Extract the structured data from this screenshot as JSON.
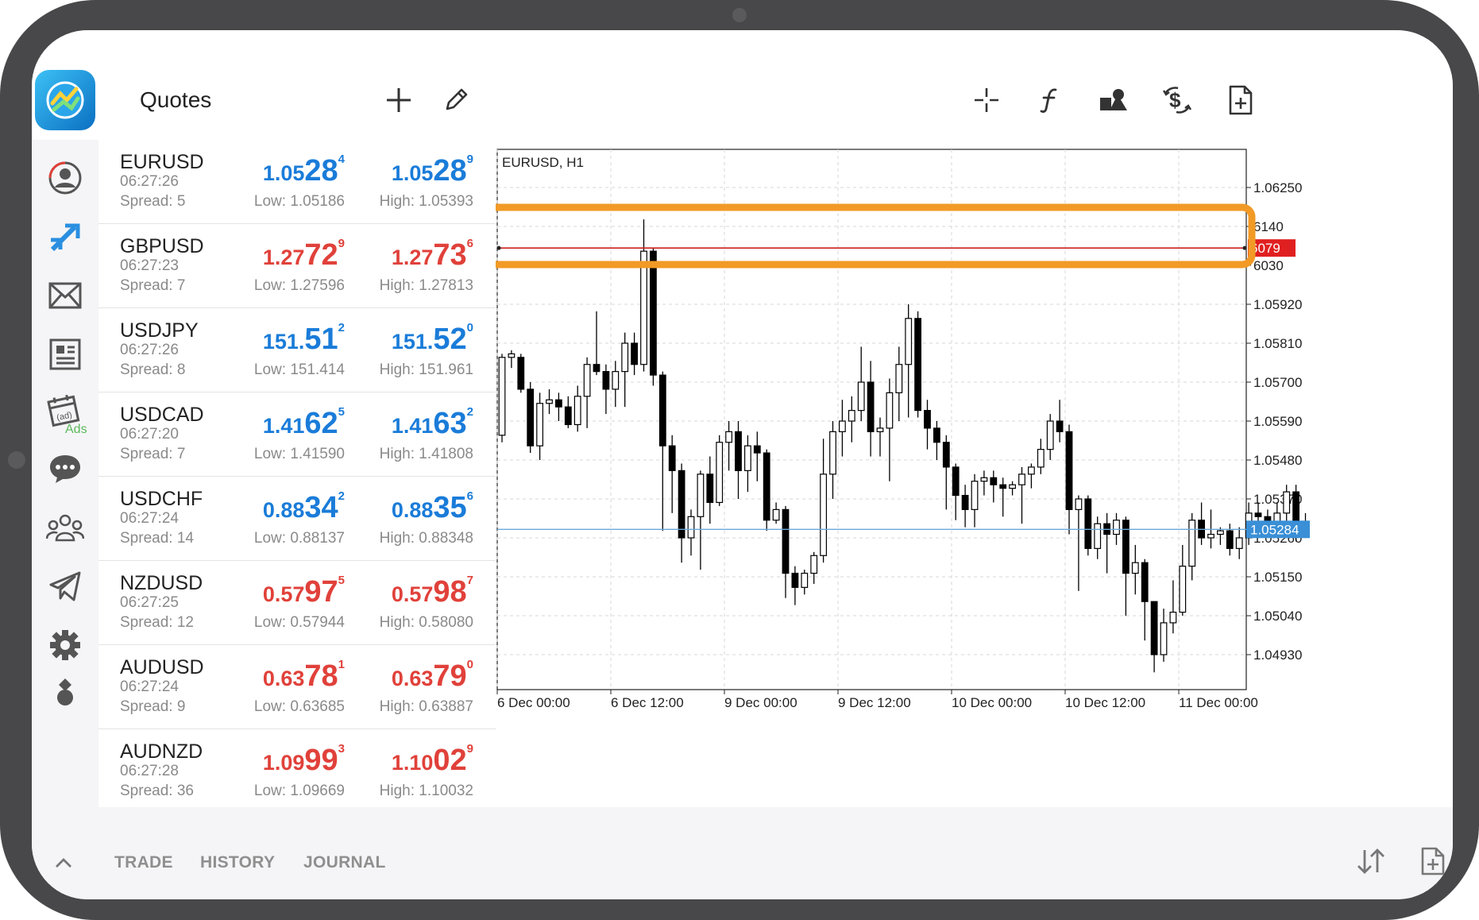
{
  "header": {
    "title": "Quotes"
  },
  "quotes": [
    {
      "symbol": "EURUSD",
      "time": "06:27:26",
      "spread": "Spread: 5",
      "bid_pre": "1.05",
      "bid_big": "28",
      "bid_sup": "4",
      "ask_pre": "1.05",
      "ask_big": "28",
      "ask_sup": "9",
      "low": "Low: 1.05186",
      "high": "High: 1.05393",
      "color": "blue"
    },
    {
      "symbol": "GBPUSD",
      "time": "06:27:23",
      "spread": "Spread: 7",
      "bid_pre": "1.27",
      "bid_big": "72",
      "bid_sup": "9",
      "ask_pre": "1.27",
      "ask_big": "73",
      "ask_sup": "6",
      "low": "Low: 1.27596",
      "high": "High: 1.27813",
      "color": "red"
    },
    {
      "symbol": "USDJPY",
      "time": "06:27:26",
      "spread": "Spread: 8",
      "bid_pre": "151.",
      "bid_big": "51",
      "bid_sup": "2",
      "ask_pre": "151.",
      "ask_big": "52",
      "ask_sup": "0",
      "low": "Low: 151.414",
      "high": "High: 151.961",
      "color": "blue"
    },
    {
      "symbol": "USDCAD",
      "time": "06:27:20",
      "spread": "Spread: 7",
      "bid_pre": "1.41",
      "bid_big": "62",
      "bid_sup": "5",
      "ask_pre": "1.41",
      "ask_big": "63",
      "ask_sup": "2",
      "low": "Low: 1.41590",
      "high": "High: 1.41808",
      "color": "blue"
    },
    {
      "symbol": "USDCHF",
      "time": "06:27:24",
      "spread": "Spread: 14",
      "bid_pre": "0.88",
      "bid_big": "34",
      "bid_sup": "2",
      "ask_pre": "0.88",
      "ask_big": "35",
      "ask_sup": "6",
      "low": "Low: 0.88137",
      "high": "High: 0.88348",
      "color": "blue"
    },
    {
      "symbol": "NZDUSD",
      "time": "06:27:25",
      "spread": "Spread: 12",
      "bid_pre": "0.57",
      "bid_big": "97",
      "bid_sup": "5",
      "ask_pre": "0.57",
      "ask_big": "98",
      "ask_sup": "7",
      "low": "Low: 0.57944",
      "high": "High: 0.58080",
      "color": "red"
    },
    {
      "symbol": "AUDUSD",
      "time": "06:27:24",
      "spread": "Spread: 9",
      "bid_pre": "0.63",
      "bid_big": "78",
      "bid_sup": "1",
      "ask_pre": "0.63",
      "ask_big": "79",
      "ask_sup": "0",
      "low": "Low: 0.63685",
      "high": "High: 0.63887",
      "color": "red"
    },
    {
      "symbol": "AUDNZD",
      "time": "06:27:28",
      "spread": "Spread: 36",
      "bid_pre": "1.09",
      "bid_big": "99",
      "bid_sup": "3",
      "ask_pre": "1.10",
      "ask_big": "02",
      "ask_sup": "9",
      "low": "Low: 1.09669",
      "high": "High: 1.10032",
      "color": "red"
    }
  ],
  "sidebar": {
    "ads_label": "Ads"
  },
  "bottom_tabs": [
    "TRADE",
    "HISTORY",
    "JOURNAL"
  ],
  "colors": {
    "bid_up": "#1a7cd9",
    "bid_down": "#e0413a",
    "highlight": "#f29a26",
    "price_line": "#6aa8d8",
    "current_price_tag": "#3a8fd6",
    "alert_line": "#cc2222"
  },
  "chart_data": {
    "type": "candlestick",
    "title": "EURUSD, H1",
    "y_ticks": [
      "1.06250",
      "6140",
      "6030",
      "1.05920",
      "1.05810",
      "1.05700",
      "1.05590",
      "1.05480",
      "1.05370",
      "1.05260",
      "1.05150",
      "1.05040",
      "1.04930"
    ],
    "x_ticks": [
      "6 Dec 00:00",
      "6 Dec 12:00",
      "9 Dec 00:00",
      "9 Dec 12:00",
      "10 Dec 00:00",
      "10 Dec 12:00",
      "11 Dec 00:00"
    ],
    "current_price": "1.05284",
    "alert_line_label": "6079",
    "ylim": [
      1.0488,
      1.0633
    ],
    "candles": [
      [
        1.0555,
        1.0577,
        1.0578,
        1.0553
      ],
      [
        1.0577,
        1.0578,
        1.0579,
        1.0574
      ],
      [
        1.0577,
        1.0568,
        1.0578,
        1.0567
      ],
      [
        1.0568,
        1.0552,
        1.057,
        1.055
      ],
      [
        1.0552,
        1.0564,
        1.0567,
        1.0548
      ],
      [
        1.0564,
        1.0565,
        1.0568,
        1.0561
      ],
      [
        1.0565,
        1.0563,
        1.0567,
        1.0559
      ],
      [
        1.0563,
        1.0558,
        1.0566,
        1.0557
      ],
      [
        1.0558,
        1.0566,
        1.0569,
        1.0556
      ],
      [
        1.0566,
        1.0575,
        1.0577,
        1.0557
      ],
      [
        1.0575,
        1.0573,
        1.059,
        1.0572
      ],
      [
        1.0573,
        1.0568,
        1.0575,
        1.0561
      ],
      [
        1.0568,
        1.0573,
        1.0576,
        1.0563
      ],
      [
        1.0573,
        1.0581,
        1.0584,
        1.0563
      ],
      [
        1.0581,
        1.0575,
        1.0584,
        1.0572
      ],
      [
        1.0575,
        1.0607,
        1.0616,
        1.0573
      ],
      [
        1.0607,
        1.0572,
        1.0608,
        1.0569
      ],
      [
        1.0572,
        1.0552,
        1.0573,
        1.0528
      ],
      [
        1.0552,
        1.0545,
        1.0555,
        1.0533
      ],
      [
        1.0545,
        1.0526,
        1.0547,
        1.0519
      ],
      [
        1.0526,
        1.0532,
        1.0534,
        1.0521
      ],
      [
        1.0532,
        1.0544,
        1.0545,
        1.0517
      ],
      [
        1.0544,
        1.0536,
        1.0549,
        1.053
      ],
      [
        1.0536,
        1.0553,
        1.0555,
        1.0535
      ],
      [
        1.0553,
        1.0556,
        1.0559,
        1.0545
      ],
      [
        1.0556,
        1.0545,
        1.0559,
        1.0537
      ],
      [
        1.0545,
        1.0552,
        1.0555,
        1.0539
      ],
      [
        1.0552,
        1.055,
        1.0556,
        1.0542
      ],
      [
        1.055,
        1.0531,
        1.0551,
        1.0528
      ],
      [
        1.0531,
        1.0534,
        1.0536,
        1.053
      ],
      [
        1.0534,
        1.0516,
        1.0535,
        1.0509
      ],
      [
        1.0516,
        1.0512,
        1.0518,
        1.0507
      ],
      [
        1.0512,
        1.0516,
        1.0517,
        1.051
      ],
      [
        1.0516,
        1.0521,
        1.0522,
        1.0513
      ],
      [
        1.0521,
        1.0544,
        1.0554,
        1.0519
      ],
      [
        1.0544,
        1.0556,
        1.0559,
        1.0537
      ],
      [
        1.0556,
        1.0559,
        1.0565,
        1.0549
      ],
      [
        1.0559,
        1.0562,
        1.0566,
        1.0553
      ],
      [
        1.0562,
        1.057,
        1.058,
        1.0559
      ],
      [
        1.057,
        1.0556,
        1.0576,
        1.0549
      ],
      [
        1.0556,
        1.0557,
        1.056,
        1.0549
      ],
      [
        1.0557,
        1.0567,
        1.0571,
        1.0542
      ],
      [
        1.0567,
        1.0575,
        1.058,
        1.0559
      ],
      [
        1.0575,
        1.0588,
        1.0592,
        1.056
      ],
      [
        1.0588,
        1.0562,
        1.059,
        1.056
      ],
      [
        1.0562,
        1.0557,
        1.0565,
        1.0551
      ],
      [
        1.0557,
        1.0553,
        1.0559,
        1.0548
      ],
      [
        1.0553,
        1.0546,
        1.0555,
        1.0534
      ],
      [
        1.0546,
        1.0538,
        1.0547,
        1.0531
      ],
      [
        1.0538,
        1.0534,
        1.0541,
        1.0529
      ],
      [
        1.0534,
        1.0542,
        1.0544,
        1.0529
      ],
      [
        1.0542,
        1.0543,
        1.0545,
        1.0538
      ],
      [
        1.0543,
        1.0541,
        1.0545,
        1.0536
      ],
      [
        1.0541,
        1.054,
        1.0543,
        1.0532
      ],
      [
        1.054,
        1.0541,
        1.0542,
        1.0538
      ],
      [
        1.0541,
        1.0544,
        1.0546,
        1.053
      ],
      [
        1.0544,
        1.0546,
        1.0547,
        1.054
      ],
      [
        1.0546,
        1.0551,
        1.0554,
        1.0544
      ],
      [
        1.0551,
        1.0559,
        1.0561,
        1.0548
      ],
      [
        1.0559,
        1.0556,
        1.0565,
        1.0553
      ],
      [
        1.0556,
        1.0534,
        1.0558,
        1.0527
      ],
      [
        1.0534,
        1.0537,
        1.0538,
        1.0511
      ],
      [
        1.0537,
        1.0523,
        1.0538,
        1.0521
      ],
      [
        1.0523,
        1.053,
        1.0532,
        1.052
      ],
      [
        1.053,
        1.0527,
        1.0533,
        1.0516
      ],
      [
        1.0527,
        1.0531,
        1.0533,
        1.0524
      ],
      [
        1.0531,
        1.0516,
        1.0532,
        1.0504
      ],
      [
        1.0516,
        1.0519,
        1.0524,
        1.051
      ],
      [
        1.0519,
        1.0508,
        1.052,
        1.0497
      ],
      [
        1.0508,
        1.0493,
        1.0508,
        1.0488
      ],
      [
        1.0493,
        1.0502,
        1.0506,
        1.0491
      ],
      [
        1.0502,
        1.0505,
        1.0514,
        1.0499
      ],
      [
        1.0505,
        1.0518,
        1.0524,
        1.0504
      ],
      [
        1.0518,
        1.0531,
        1.0533,
        1.0514
      ],
      [
        1.0531,
        1.0526,
        1.0536,
        1.0524
      ],
      [
        1.0526,
        1.0527,
        1.0534,
        1.0523
      ],
      [
        1.0527,
        1.0528,
        1.0529,
        1.0524
      ],
      [
        1.0528,
        1.0523,
        1.053,
        1.0521
      ],
      [
        1.0523,
        1.0526,
        1.0529,
        1.052
      ],
      [
        1.0526,
        1.0533,
        1.0536,
        1.0524
      ],
      [
        1.0533,
        1.0532,
        1.0536,
        1.0528
      ],
      [
        1.0532,
        1.053,
        1.0534,
        1.0527
      ],
      [
        1.053,
        1.0533,
        1.0536,
        1.0528
      ],
      [
        1.0533,
        1.0539,
        1.0541,
        1.0529
      ],
      [
        1.0539,
        1.053,
        1.0541,
        1.0525
      ],
      [
        1.053,
        1.0528,
        1.0533,
        1.0527
      ]
    ]
  }
}
